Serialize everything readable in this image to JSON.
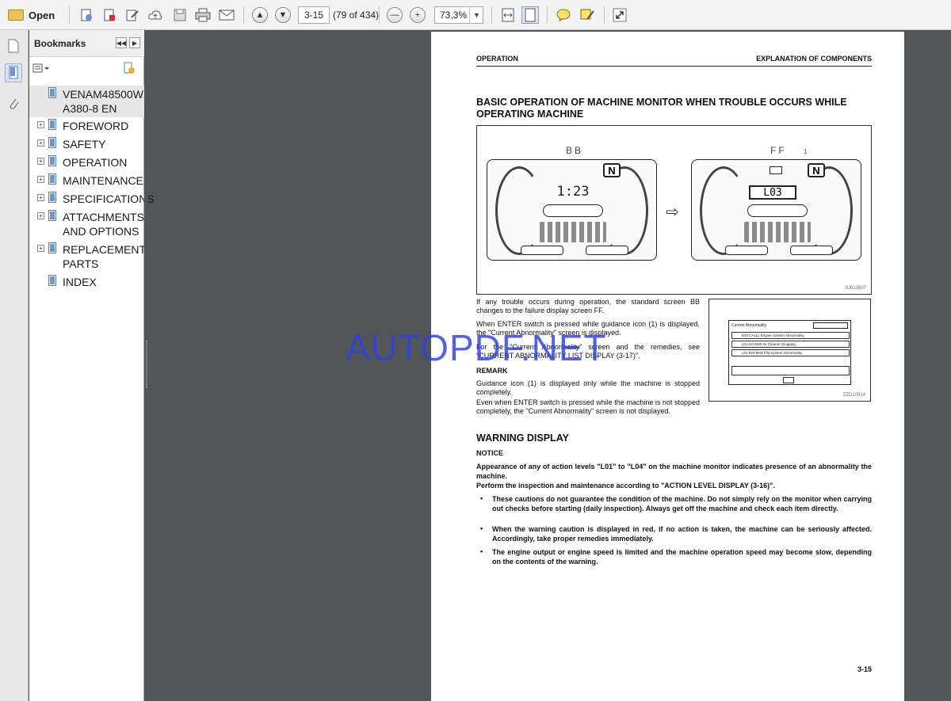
{
  "toolbar": {
    "open_label": "Open",
    "page_value": "3-15",
    "page_count": "(79 of 434)",
    "zoom_value": "73,3%"
  },
  "bookmarks": {
    "title": "Bookmarks",
    "items": [
      {
        "label": "VENAM48500W A380-8 EN",
        "expandable": false
      },
      {
        "label": "FOREWORD",
        "expandable": true
      },
      {
        "label": "SAFETY",
        "expandable": true
      },
      {
        "label": "OPERATION",
        "expandable": true
      },
      {
        "label": "MAINTENANCE",
        "expandable": true
      },
      {
        "label": "SPECIFICATIONS",
        "expandable": true
      },
      {
        "label": "ATTACHMENTS AND OPTIONS",
        "expandable": true
      },
      {
        "label": "REPLACEMENT PARTS",
        "expandable": true
      },
      {
        "label": "INDEX",
        "expandable": false
      }
    ]
  },
  "document": {
    "header_left": "OPERATION",
    "header_right": "EXPLANATION OF COMPONENTS",
    "section_title": "BASIC OPERATION OF MACHINE MONITOR WHEN TROUBLE OCCURS WHILE OPERATING MACHINE",
    "figure1": {
      "label_bb": "BB",
      "label_ff": "FF",
      "callout": "1",
      "time": "1:23",
      "level": "L03",
      "code": "9J013507"
    },
    "para1": "If any trouble occurs during operation, the standard screen BB changes to the failure display screen FF.",
    "para2": "When ENTER switch is pressed while guidance icon (1) is displayed, the \"Current Abnormality\" screen is displayed.",
    "para3": "For the \"Current Abnormality\" screen and the remedies, see \"CURRENT ABNORMALITY LIST DISPLAY (3-17)\".",
    "remark_heading": "REMARK",
    "remark1": "Guidance icon (1) is displayed only while the machine is stopped completely.",
    "remark2": "Even when ENTER switch is pressed while the machine is not stopped completely, the \"Current Abnormality\" screen is not displayed.",
    "figure2": {
      "title": "Current Abnormality",
      "rows": [
        "E03 CA111 Engine System Abnormality",
        "L01 AA1N00 Air Cleaner Clogging",
        "L01 DAF8KB T/M System Abnormality"
      ],
      "code": "ZZD10514"
    },
    "warning_heading": "WARNING DISPLAY",
    "notice_heading": "NOTICE",
    "notice1": "Appearance of any of action levels \"L01\" to \"L04\" on the machine monitor indicates presence of an abnormality the machine.",
    "notice2": "Perform the inspection and maintenance according to \"ACTION LEVEL DISPLAY (3-16)\".",
    "bullets": [
      "These cautions do not guarantee the condition of the machine. Do not simply rely on the monitor when carrying out checks before starting (daily inspection). Always get off the machine and check each item directly.",
      "When the warning caution is displayed in red, if no action is taken, the machine can be seriously affected. Accordingly, take proper remedies immediately.",
      "The engine output or engine speed is limited and the machine operation speed may become slow, depending on the contents of the warning."
    ],
    "page_number": "3-15"
  },
  "watermark": "AUTOPDF.NET",
  "colors": {
    "watermark": "#2f3fe0",
    "viewer_bg": "#525659",
    "toolbar_bg": "#f3f3f3"
  }
}
